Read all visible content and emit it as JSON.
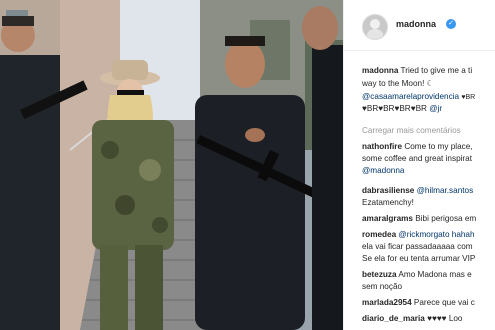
{
  "post": {
    "author": "madonna",
    "verified_icon": "verified-badge-icon",
    "caption_user": "madonna",
    "caption_text": "Tried to give me a ti",
    "caption_cont": "way to the Moon!",
    "moon_icon": "crescent-moon-icon",
    "caption_tags": "@casaamarelaprovidencia",
    "caption_hearts": "♥BR♥BR♥BR♥BR",
    "caption_tag2": "@jr",
    "load_more": "Carregar mais comentários"
  },
  "comments": [
    {
      "user": "nathonfire",
      "text": "Come to my place,",
      "cont": [
        "some coffee and great inspirat",
        "@madonna"
      ]
    },
    {
      "user": "dabrasiliense",
      "text": "@hilmar.santos",
      "cont": [
        "Ezatamenchy!"
      ]
    },
    {
      "user": "amaralgrams",
      "text": "Bibi perigosa em",
      "cont": []
    },
    {
      "user": "romedea",
      "text": "@rickmorgato hahah",
      "cont": [
        "ela vai ficar passadaaaaa com",
        "Se ela for eu tenta arrumar VIP"
      ]
    },
    {
      "user": "betezuza",
      "text": "Amo Madona mas e",
      "cont": [
        "sem noção"
      ]
    },
    {
      "user": "marlada2954",
      "text": "Parece que vai c",
      "cont": []
    },
    {
      "user": "diario_de_maria",
      "text": "♥♥♥♥ Loo",
      "cont": []
    }
  ],
  "colors": {
    "accent": "#3897f0",
    "text": "#262626",
    "muted": "#999999",
    "tag": "#003569"
  }
}
